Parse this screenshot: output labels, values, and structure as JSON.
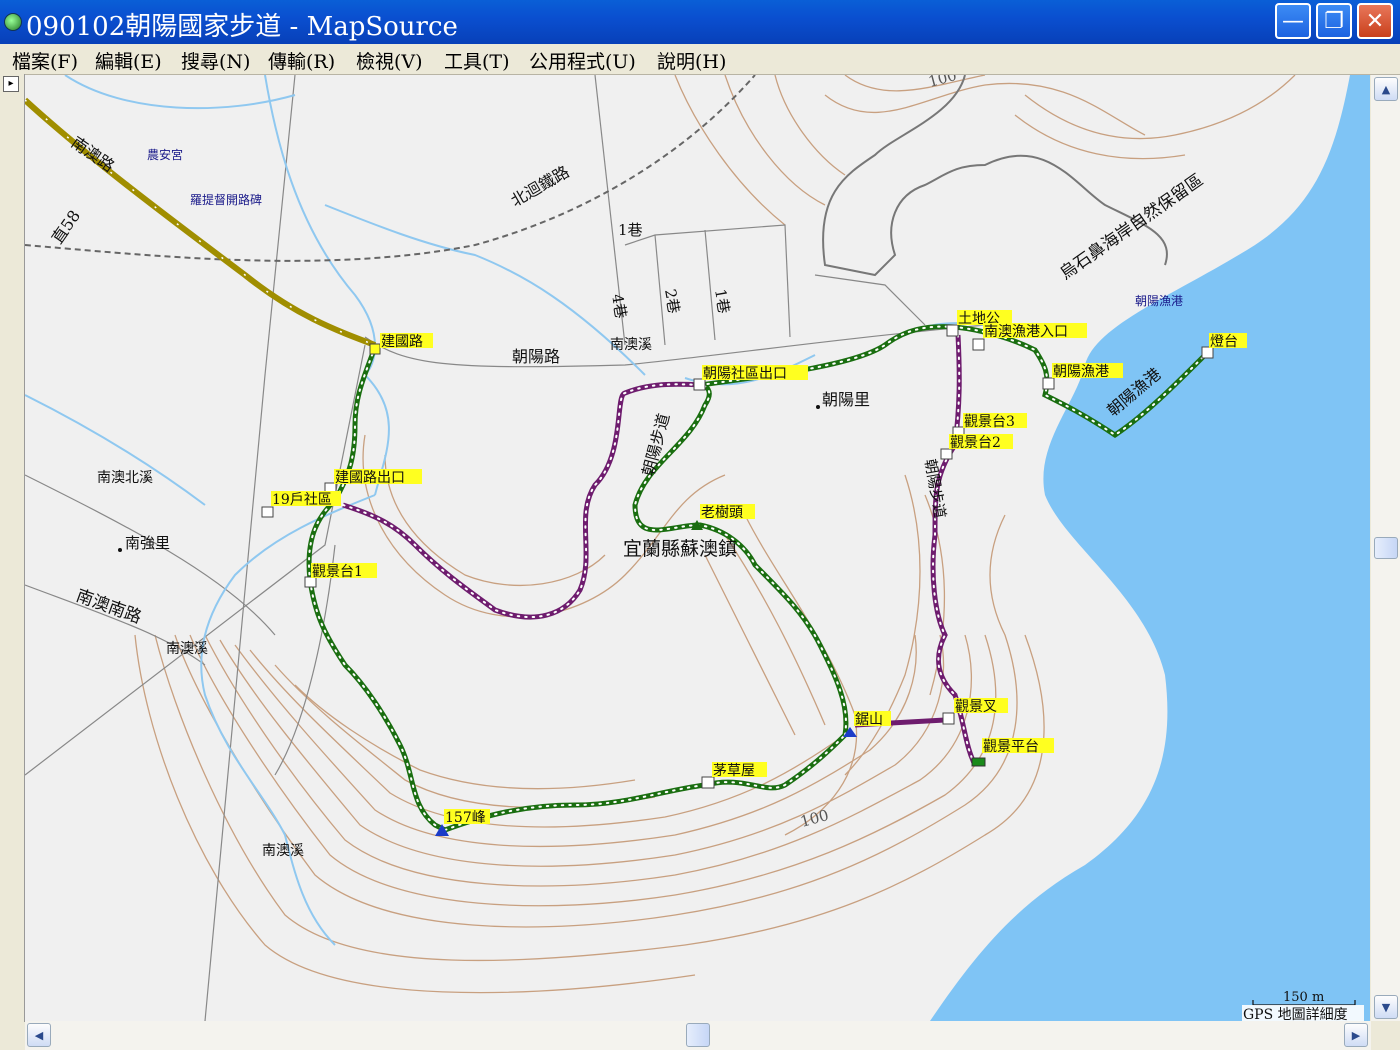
{
  "window": {
    "title": "090102朝陽國家步道 - MapSource",
    "minimize_glyph": "—",
    "maximize_glyph": "❐",
    "close_glyph": "✕"
  },
  "menu": [
    "檔案(F)",
    "編輯(E)",
    "搜尋(N)",
    "傳輸(R)",
    "檢視(V)",
    "工具(T)",
    "公用程式(U)",
    "說明(H)"
  ],
  "map": {
    "contour_label": "100",
    "road_labels": [
      "南澳路",
      "直58",
      "北迴鐵路",
      "朝陽路",
      "南澳南路",
      "1巷",
      "2巷",
      "4巷",
      "1巷"
    ],
    "place_labels": [
      "農安宮",
      "羅提督開路碑",
      "南澳北溪",
      "南強里",
      "南澳溪",
      "南澳溪",
      "南澳溪",
      "朝陽里",
      "宜蘭縣蘇澳鎮",
      "朝陽漁港",
      "烏石鼻海岸自然保留區",
      "朝陽漁港"
    ],
    "trail_labels": [
      "朝陽步道",
      "朝陽步道",
      "朝陽漁港"
    ],
    "waypoints": [
      "建國路",
      "建國路出口",
      "19戶社區",
      "觀景台1",
      "157峰",
      "茅草屋",
      "老樹頭",
      "朝陽社區出口",
      "土地公",
      "南澳漁港入口",
      "朝陽漁港",
      "燈台",
      "觀景台3",
      "觀景台2",
      "觀景叉",
      "觀景平台",
      "鋸山"
    ],
    "scale_distance": "150 m",
    "scale_caption": "GPS 地圖詳細度",
    "colors": {
      "sea": "#7fc4f5",
      "land": "#efefef",
      "contour": "#c8a080",
      "track_green": "#1a6e10",
      "track_purple": "#6e1c6e",
      "waypoint_label_bg": "#ffff20",
      "rail": "#777777",
      "highway": "#a08e00"
    }
  },
  "scroll": {
    "up_glyph": "▲",
    "down_glyph": "▼",
    "left_glyph": "◀",
    "right_glyph": "▶",
    "expand_glyph": "▸"
  }
}
